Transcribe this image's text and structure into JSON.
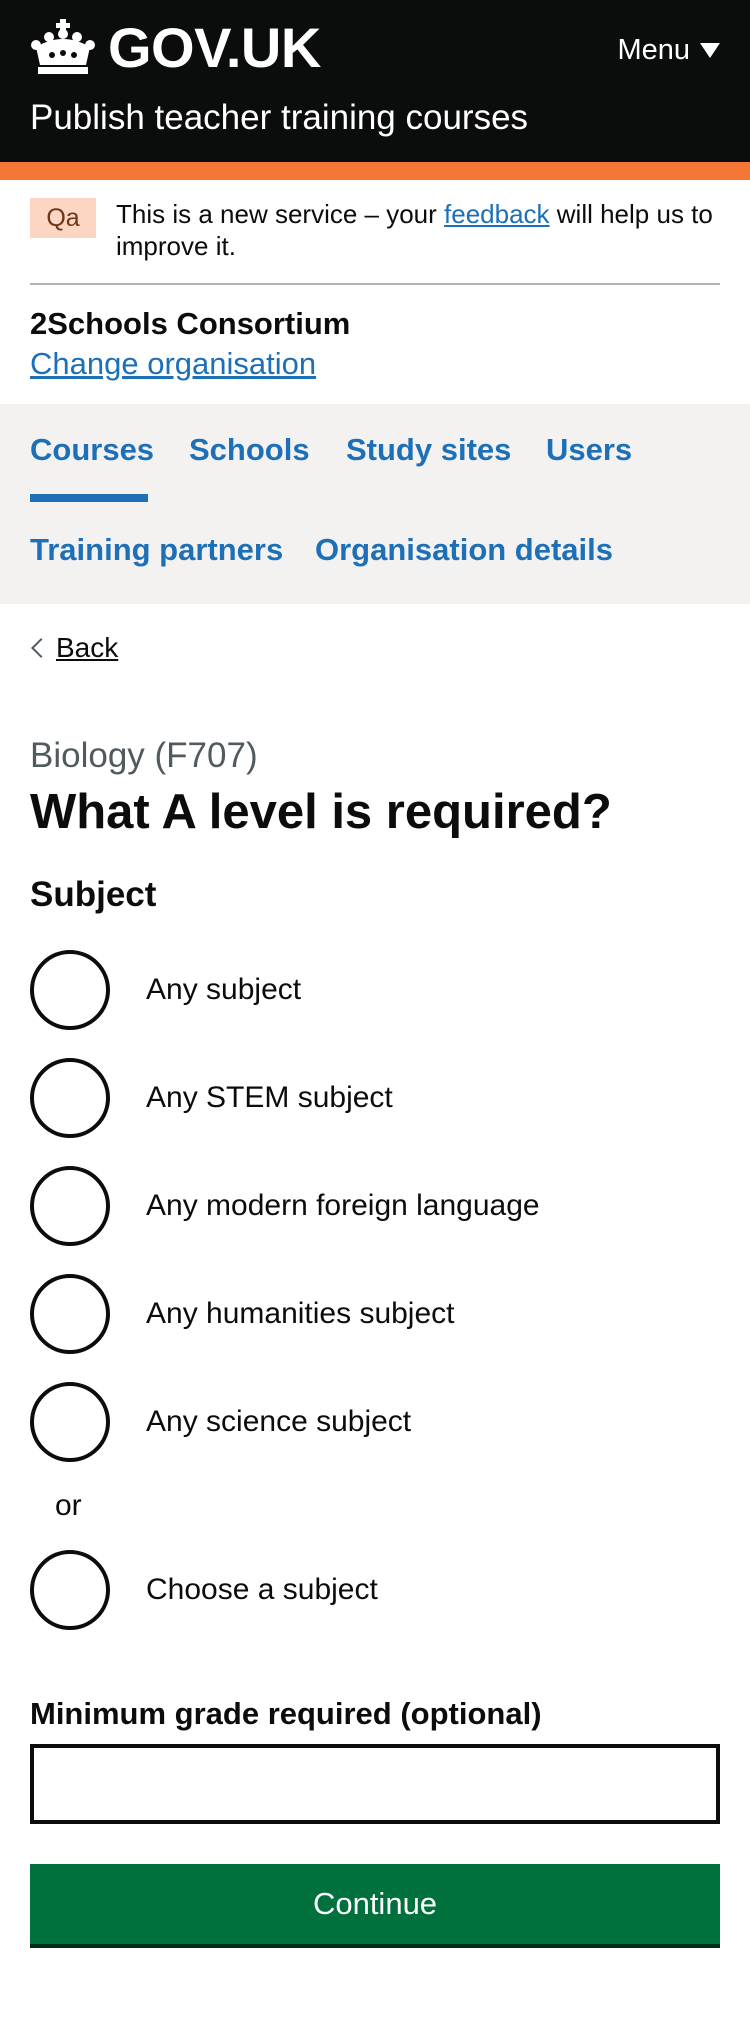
{
  "header": {
    "logo_text": "GOV.UK",
    "menu_label": "Menu",
    "service_name": "Publish teacher training courses"
  },
  "phase_banner": {
    "tag": "Qa",
    "text_before": "This is a new service – your ",
    "link_text": "feedback",
    "text_after": " will help us to improve it."
  },
  "organisation": {
    "name": "2Schools Consortium",
    "change_link": "Change organisation"
  },
  "nav": {
    "items": [
      {
        "label": "Courses",
        "active": true
      },
      {
        "label": "Schools",
        "active": false
      },
      {
        "label": "Study sites",
        "active": false
      },
      {
        "label": "Users",
        "active": false
      },
      {
        "label": "Training partners",
        "active": false
      },
      {
        "label": "Organisation details",
        "active": false
      }
    ]
  },
  "back_link": "Back",
  "page": {
    "caption": "Biology (F707)",
    "title": "What A level is required?",
    "legend": "Subject"
  },
  "options": [
    {
      "label": "Any subject",
      "checked": false
    },
    {
      "label": "Any STEM subject",
      "checked": false
    },
    {
      "label": "Any modern foreign language",
      "checked": false
    },
    {
      "label": "Any humanities subject",
      "checked": false
    },
    {
      "label": "Any science subject",
      "checked": false
    },
    {
      "label": "Choose a subject",
      "checked": false
    }
  ],
  "or_divider": "or",
  "grade": {
    "label": "Minimum grade required (optional)",
    "value": ""
  },
  "continue_button": "Continue",
  "colors": {
    "header_bg": "#0b0c0c",
    "accent": "#f47738",
    "link": "#1d70b8",
    "button": "#00703c",
    "tag_bg": "#fcd6c3"
  }
}
